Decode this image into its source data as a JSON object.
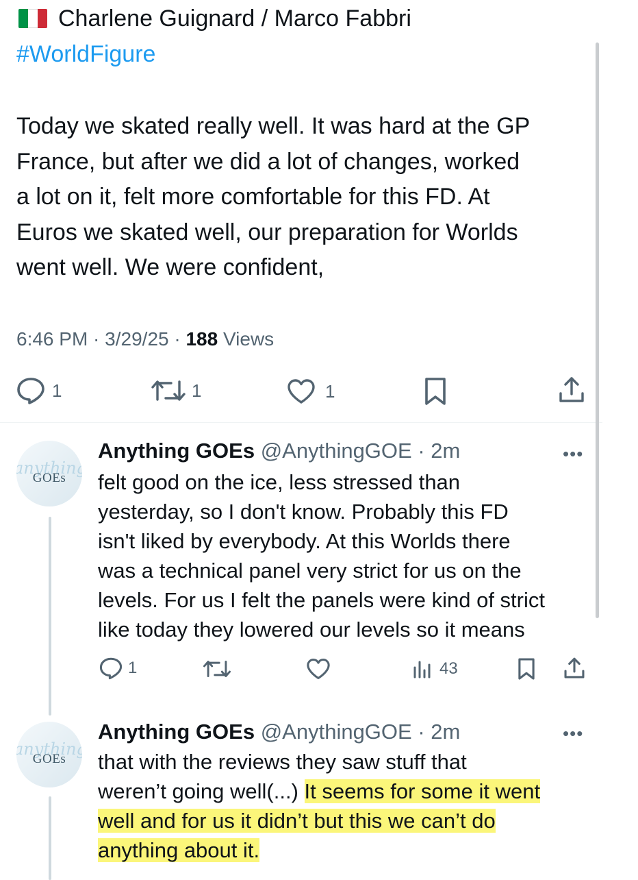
{
  "tweet": {
    "flag_icon": "italy-flag-icon",
    "flag_colors": [
      "#009246",
      "#ffffff",
      "#ce2b37"
    ],
    "title": "Charlene Guignard / Marco Fabbri",
    "hashtag": "#WorldFigure",
    "body_lines": [
      "Today we skated really well. It was hard at the GP",
      "France, but after we did a lot of changes, worked",
      "a lot on it, felt more comfortable for this FD. At",
      "Euros we skated well, our preparation for Worlds",
      "went well. We were confident,"
    ],
    "time": "6:46 PM",
    "date": "3/29/25",
    "views_count": "188",
    "views_label": "Views",
    "actions": {
      "reply_count": "1",
      "retweet_count": "1",
      "like_count": "1"
    }
  },
  "replies": [
    {
      "avatar_script": "anything",
      "avatar_text": "GOEs",
      "name": "Anything GOEs",
      "handle": "@AnythingGOE",
      "time": "2m",
      "lines": [
        "felt good on the ice, less stressed than",
        "yesterday, so I don't know. Probably this FD",
        "isn't liked by everybody. At this Worlds there",
        "was a technical panel very strict for us on the",
        "levels. For us I felt the panels were kind of strict",
        "like today they lowered our levels so it means"
      ],
      "reply_count": "1",
      "views_count": "43"
    },
    {
      "avatar_script": "anything",
      "avatar_text": "GOEs",
      "name": "Anything GOEs",
      "handle": "@AnythingGOE",
      "time": "2m",
      "line1": "that with the reviews they saw stuff that",
      "line2_plain": "weren’t going well(...) ",
      "line2_highlight": "It seems for some it went",
      "line3": "well and for us it didn’t but this we can’t do",
      "line4": "anything about it.",
      "highlight_color": "#fbf67a"
    }
  ],
  "colors": {
    "link": "#1d9bf0",
    "secondary_text": "#536471",
    "primary_text": "#0f1419"
  }
}
